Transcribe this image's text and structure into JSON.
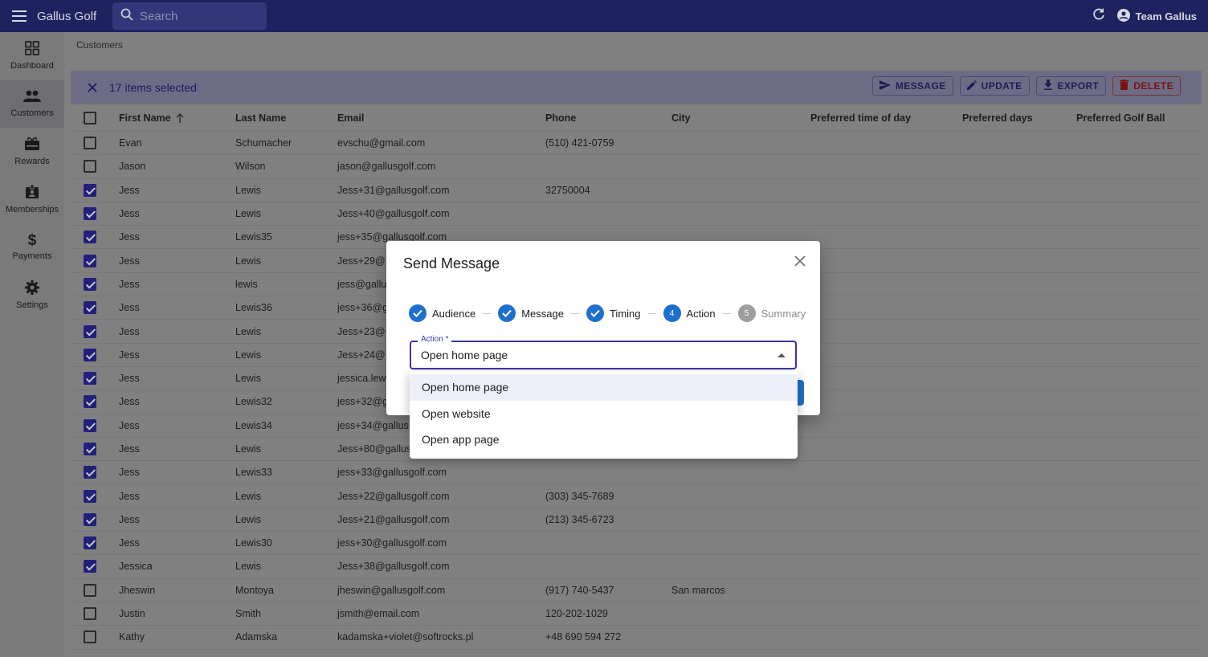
{
  "app": {
    "title": "Gallus Golf",
    "user": "Team Gallus"
  },
  "search": {
    "placeholder": "Search"
  },
  "sidebar": {
    "items": [
      {
        "label": "Dashboard",
        "icon": "dashboard-icon"
      },
      {
        "label": "Customers",
        "icon": "people-icon"
      },
      {
        "label": "Rewards",
        "icon": "gift-icon"
      },
      {
        "label": "Memberships",
        "icon": "badge-icon"
      },
      {
        "label": "Payments",
        "icon": "dollar-icon"
      },
      {
        "label": "Settings",
        "icon": "gear-icon"
      }
    ],
    "active": "Customers"
  },
  "breadcrumb": "Customers",
  "selection": {
    "text": "17 items selected",
    "actions": {
      "message": "MESSAGE",
      "update": "UPDATE",
      "export": "EXPORT",
      "delete": "DELETE"
    }
  },
  "table": {
    "columns": [
      "First Name",
      "Last Name",
      "Email",
      "Phone",
      "City",
      "Preferred time of day",
      "Preferred days",
      "Preferred Golf Ball"
    ],
    "sort": {
      "column": "First Name",
      "direction": "ascending"
    },
    "rows": [
      {
        "checked": false,
        "first": "Evan",
        "last": "Schumacher",
        "email": "evschu@gmail.com",
        "phone": "(510) 421-0759",
        "city": ""
      },
      {
        "checked": false,
        "first": "Jason",
        "last": "Wilson",
        "email": "jason@gallusgolf.com",
        "phone": "",
        "city": ""
      },
      {
        "checked": true,
        "first": "Jess",
        "last": "Lewis",
        "email": "Jess+31@gallusgolf.com",
        "phone": "32750004",
        "city": ""
      },
      {
        "checked": true,
        "first": "Jess",
        "last": "Lewis",
        "email": "Jess+40@gallusgolf.com",
        "phone": "",
        "city": ""
      },
      {
        "checked": true,
        "first": "Jess",
        "last": "Lewis35",
        "email": "jess+35@gallusgolf.com",
        "phone": "",
        "city": ""
      },
      {
        "checked": true,
        "first": "Jess",
        "last": "Lewis",
        "email": "Jess+29@",
        "phone": "",
        "city": ""
      },
      {
        "checked": true,
        "first": "Jess",
        "last": "lewis",
        "email": "jess@gallu",
        "phone": "",
        "city": ""
      },
      {
        "checked": true,
        "first": "Jess",
        "last": "Lewis36",
        "email": "jess+36@g",
        "phone": "",
        "city": ""
      },
      {
        "checked": true,
        "first": "Jess",
        "last": "Lewis",
        "email": "Jess+23@",
        "phone": "",
        "city": ""
      },
      {
        "checked": true,
        "first": "Jess",
        "last": "Lewis",
        "email": "Jess+24@",
        "phone": "",
        "city": ""
      },
      {
        "checked": true,
        "first": "Jess",
        "last": "Lewis",
        "email": "jessica.lew",
        "phone": "",
        "city": ""
      },
      {
        "checked": true,
        "first": "Jess",
        "last": "Lewis32",
        "email": "jess+32@g",
        "phone": "",
        "city": ""
      },
      {
        "checked": true,
        "first": "Jess",
        "last": "Lewis34",
        "email": "jess+34@gallus",
        "phone": "",
        "city": ""
      },
      {
        "checked": true,
        "first": "Jess",
        "last": "Lewis",
        "email": "Jess+80@gallus",
        "phone": "",
        "city": ""
      },
      {
        "checked": true,
        "first": "Jess",
        "last": "Lewis33",
        "email": "jess+33@gallusgolf.com",
        "phone": "",
        "city": ""
      },
      {
        "checked": true,
        "first": "Jess",
        "last": "Lewis",
        "email": "Jess+22@gallusgolf.com",
        "phone": "(303) 345-7689",
        "city": ""
      },
      {
        "checked": true,
        "first": "Jess",
        "last": "Lewis",
        "email": "Jess+21@gallusgolf.com",
        "phone": "(213) 345-6723",
        "city": ""
      },
      {
        "checked": true,
        "first": "Jess",
        "last": "Lewis30",
        "email": "jess+30@gallusgolf.com",
        "phone": "",
        "city": ""
      },
      {
        "checked": true,
        "first": "Jessica",
        "last": "Lewis",
        "email": "Jess+38@gallusgolf.com",
        "phone": "",
        "city": ""
      },
      {
        "checked": false,
        "first": "Jheswin",
        "last": "Montoya",
        "email": "jheswin@gallusgolf.com",
        "phone": "(917) 740-5437",
        "city": "San marcos"
      },
      {
        "checked": false,
        "first": "Justin",
        "last": "Smith",
        "email": "jsmith@email.com",
        "phone": "120-202-1029",
        "city": ""
      },
      {
        "checked": false,
        "first": "Kathy",
        "last": "Adamska",
        "email": "kadamska+violet@softrocks.pl",
        "phone": "+48 690 594 272",
        "city": ""
      }
    ]
  },
  "dialog": {
    "title": "Send Message",
    "steps": [
      {
        "label": "Audience",
        "state": "done"
      },
      {
        "label": "Message",
        "state": "done"
      },
      {
        "label": "Timing",
        "state": "done"
      },
      {
        "label": "Action",
        "state": "active",
        "number": "4"
      },
      {
        "label": "Summary",
        "state": "inactive",
        "number": "5"
      }
    ],
    "action_field": {
      "label": "Action *",
      "value": "Open home page"
    },
    "options": [
      "Open home page",
      "Open website",
      "Open app page"
    ],
    "selected_option": "Open home page"
  },
  "colors": {
    "appbar": "#1e225f",
    "accent": "#1f6fcf",
    "focus": "#3a35a8",
    "checkbox": "#21207a",
    "delete": "#7a1111"
  }
}
